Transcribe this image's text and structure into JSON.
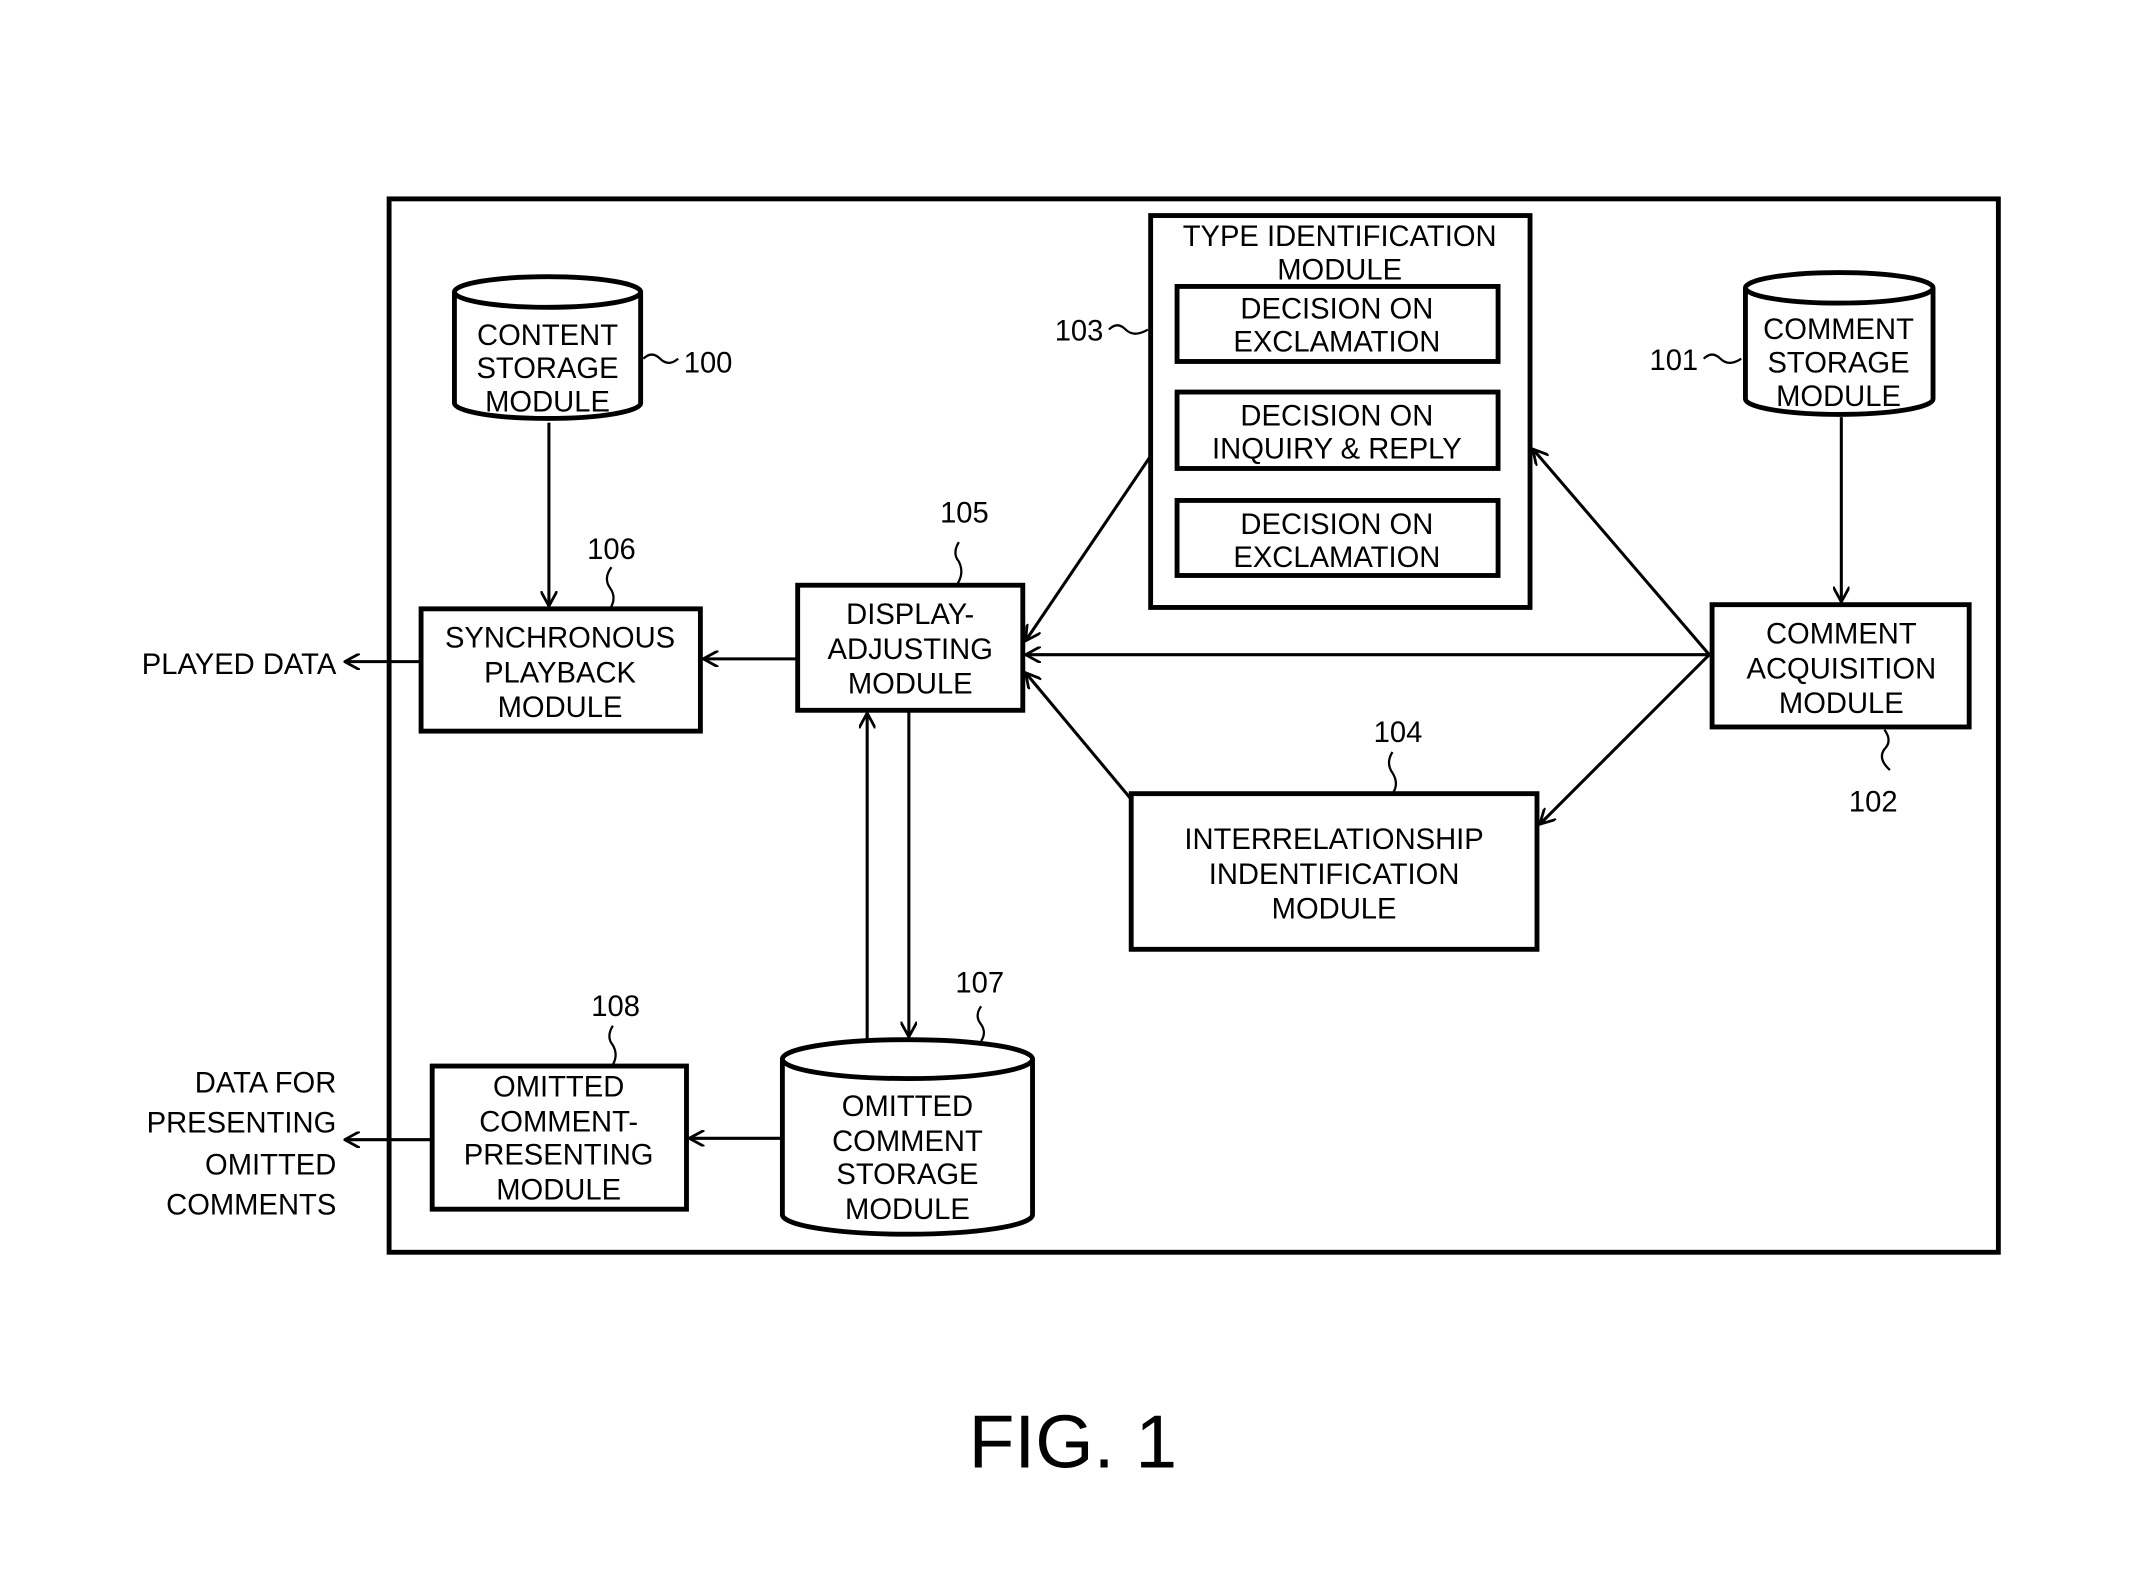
{
  "figure_label": "FIG. 1",
  "modules": {
    "content_storage": {
      "ref": "100",
      "lines": [
        "CONTENT",
        "STORAGE",
        "MODULE"
      ]
    },
    "comment_storage": {
      "ref": "101",
      "lines": [
        "COMMENT",
        "STORAGE",
        "MODULE"
      ]
    },
    "comment_acquisition": {
      "ref": "102",
      "lines": [
        "COMMENT",
        "ACQUISITION",
        "MODULE"
      ]
    },
    "type_identification": {
      "ref": "103",
      "lines": [
        "TYPE IDENTIFICATION",
        "MODULE"
      ],
      "sub_decisions": [
        {
          "lines": [
            "DECISION ON",
            "EXCLAMATION"
          ]
        },
        {
          "lines": [
            "DECISION ON",
            "INQUIRY & REPLY"
          ]
        },
        {
          "lines": [
            "DECISION ON",
            "EXCLAMATION"
          ]
        }
      ]
    },
    "interrelationship_identification": {
      "ref": "104",
      "lines": [
        "INTERRELATIONSHIP",
        "INDENTIFICATION",
        "MODULE"
      ]
    },
    "display_adjusting": {
      "ref": "105",
      "lines": [
        "DISPLAY-",
        "ADJUSTING",
        "MODULE"
      ]
    },
    "synchronous_playback": {
      "ref": "106",
      "lines": [
        "SYNCHRONOUS",
        "PLAYBACK",
        "MODULE"
      ]
    },
    "omitted_comment_storage": {
      "ref": "107",
      "lines": [
        "OMITTED",
        "COMMENT",
        "STORAGE",
        "MODULE"
      ]
    },
    "omitted_comment_presenting": {
      "ref": "108",
      "lines": [
        "OMITTED",
        "COMMENT-",
        "PRESENTING",
        "MODULE"
      ]
    }
  },
  "outputs": {
    "played_data": "PLAYED DATA",
    "omitted_data": [
      "DATA FOR",
      "PRESENTING",
      "OMITTED",
      "COMMENTS"
    ]
  }
}
